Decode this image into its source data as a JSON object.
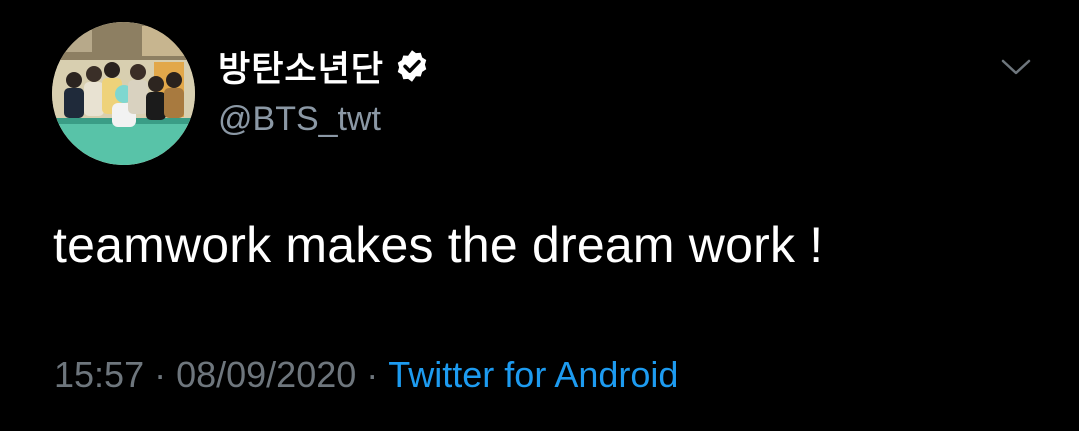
{
  "tweet": {
    "author": {
      "display_name": "방탄소년단",
      "handle": "@BTS_twt",
      "verified": true,
      "avatar": "group-photo-avatar"
    },
    "menu_icon": "chevron-down-icon",
    "text": "teamwork makes the dream work !",
    "time": "15:57",
    "separator": "·",
    "date": "08/09/2020",
    "source": "Twitter for Android"
  },
  "colors": {
    "background": "#000000",
    "text_primary": "#ffffff",
    "text_muted": "#8b98a5",
    "link": "#1d9bf0"
  }
}
